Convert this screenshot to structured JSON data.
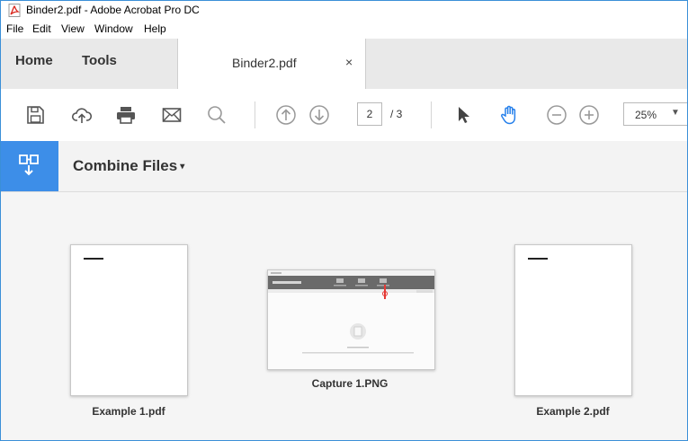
{
  "window": {
    "title": "Binder2.pdf - Adobe Acrobat Pro DC"
  },
  "menu": [
    "File",
    "Edit",
    "View",
    "Window",
    "Help"
  ],
  "tabs": {
    "home": "Home",
    "tools": "Tools",
    "document": "Binder2.pdf",
    "close": "×"
  },
  "toolbar": {
    "icons": [
      "save-icon",
      "cloud-upload-icon",
      "print-icon",
      "email-icon",
      "search-icon",
      "previous-page-icon",
      "next-page-icon",
      "select-cursor-icon",
      "hand-tool-icon",
      "zoom-out-icon",
      "zoom-in-icon"
    ],
    "page_current": "2",
    "page_total": "/ 3",
    "zoom": "25%",
    "zoom_caret": "▼"
  },
  "combine": {
    "label": "Combine Files",
    "caret": "▾"
  },
  "files": [
    {
      "name": "Example 1.pdf"
    },
    {
      "name": "Capture 1.PNG"
    },
    {
      "name": "Example 2.pdf"
    }
  ],
  "colors": {
    "accent": "#3d8ee8",
    "pdf_red": "#d9261c",
    "active_tool": "#2680eb"
  }
}
